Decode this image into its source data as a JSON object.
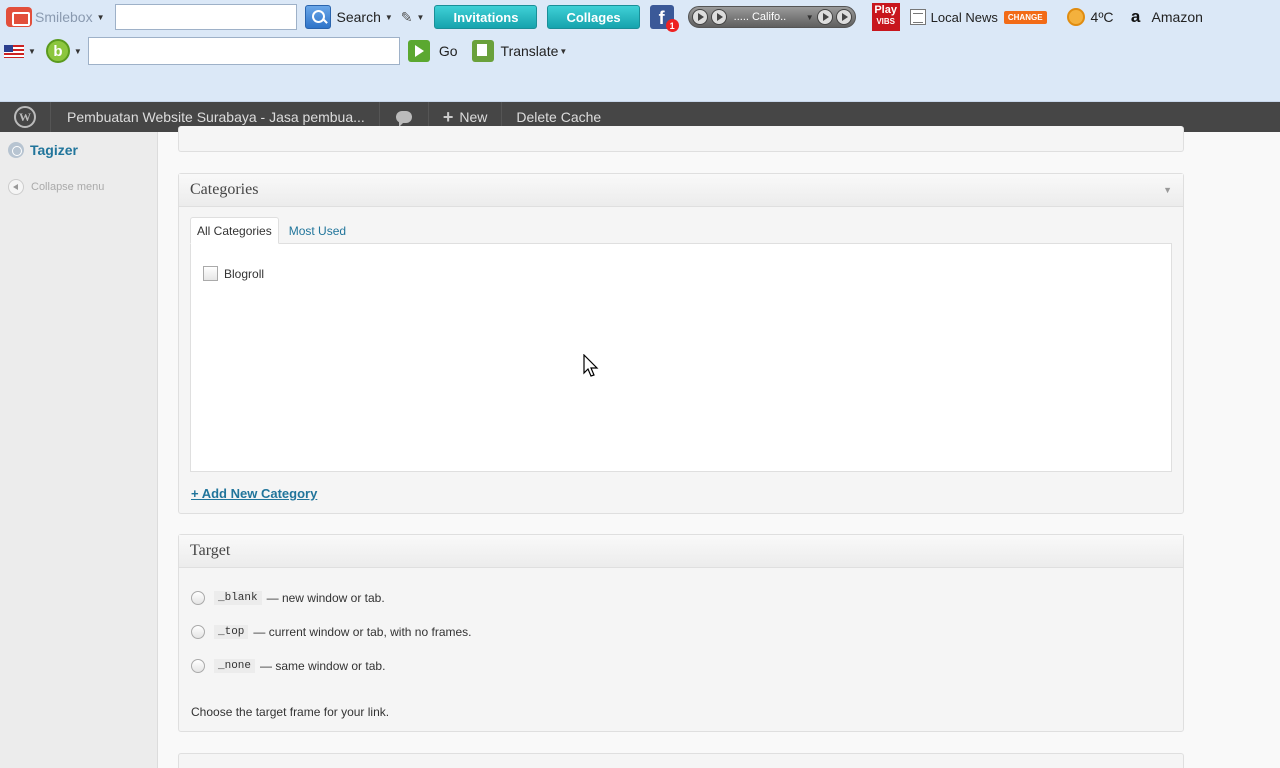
{
  "toolbar": {
    "smilebox_label": "Smilebox",
    "search_label": "Search",
    "invitations_label": "Invitations",
    "collages_label": "Collages",
    "facebook_glyph": "f",
    "facebook_badge": "1",
    "radio_station": "..... Califo..",
    "play_label_top": "Play",
    "play_label_bottom": "VIBS",
    "local_news_label": "Local News",
    "change_badge": "CHANGE",
    "weather_label": "4ºC",
    "amazon_glyph": "a",
    "amazon_label": "Amazon",
    "b_glyph": "b",
    "go_label": "Go",
    "translate_label": "Translate",
    "search_input_value": "",
    "address_input_value": ""
  },
  "adminbar": {
    "site_title": "Pembuatan Website Surabaya - Jasa pembua...",
    "new_label": "New",
    "delete_cache_label": "Delete Cache",
    "wp_glyph": "W"
  },
  "sidemenu": {
    "tagizer_label": "Tagizer",
    "collapse_label": "Collapse menu"
  },
  "categories": {
    "title": "Categories",
    "tabs": [
      {
        "label": "All Categories",
        "active": true
      },
      {
        "label": "Most Used",
        "active": false
      }
    ],
    "items": [
      {
        "label": "Blogroll",
        "checked": false
      }
    ],
    "add_new_label": "+ Add New Category"
  },
  "target": {
    "title": "Target",
    "options": [
      {
        "code": "_blank",
        "description": "— new window or tab."
      },
      {
        "code": "_top",
        "description": "— current window or tab, with no frames."
      },
      {
        "code": "_none",
        "description": "— same window or tab."
      }
    ],
    "help": "Choose the target frame for your link."
  },
  "colors": {
    "admin_bar": "#464646",
    "link_blue": "#21759b",
    "toolbar_bg": "#dbe8f7",
    "teal_button": "#16a3ad"
  }
}
